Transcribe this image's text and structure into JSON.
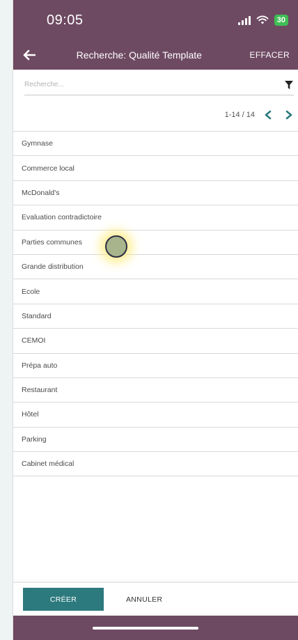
{
  "status_bar": {
    "time": "09:05",
    "battery": "30",
    "icons": [
      "signal-icon",
      "wifi-icon",
      "battery-icon"
    ]
  },
  "app_bar": {
    "title": "Recherche: Qualité Template",
    "clear_label": "EFFACER",
    "back_icon": "arrow-left-icon"
  },
  "search": {
    "placeholder": "Recherche...",
    "value": "",
    "filter_icon": "filter-icon"
  },
  "pager": {
    "value": "1-14 / 14",
    "prev_icon": "chevron-left-icon",
    "next_icon": "chevron-right-icon"
  },
  "list": {
    "items": [
      "Gymnase",
      "Commerce local",
      "McDonald's",
      "Evaluation contradictoire",
      "Parties communes",
      "Grande distribution",
      "Ecole",
      "Standard",
      "CEMOI",
      "Prépa auto",
      "Restaurant",
      "Hôtel",
      "Parking",
      "Cabinet médical"
    ]
  },
  "footer": {
    "create_label": "CRÉER",
    "cancel_label": "ANNULER"
  },
  "colors": {
    "header": "#6e4a62",
    "primary_button": "#2c7a7e",
    "pager_arrows": "#2c7a7e",
    "battery": "#3fbe55"
  }
}
